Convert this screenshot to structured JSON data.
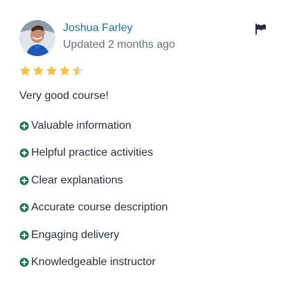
{
  "review": {
    "reviewer_name": "Joshua Farley",
    "updated_text": "Updated 2 months ago",
    "rating": 4.5,
    "rating_max": 5,
    "comment": "Very good course!",
    "tags": [
      "Valuable information",
      "Helpful practice activities",
      "Clear explanations",
      "Accurate course description",
      "Engaging delivery",
      "Knowledgeable instructor"
    ]
  },
  "colors": {
    "name_link": "#1f6f8b",
    "muted_text": "#686f7a",
    "body_text": "#29303b",
    "star_fill": "#f4c150",
    "star_empty": "#dedfe0",
    "tag_icon": "#277556",
    "flag": "#29303b"
  },
  "icons": {
    "avatar": "reviewer-avatar",
    "flag": "flag-icon",
    "star": "star-icon",
    "tag": "plus-circle-icon"
  }
}
